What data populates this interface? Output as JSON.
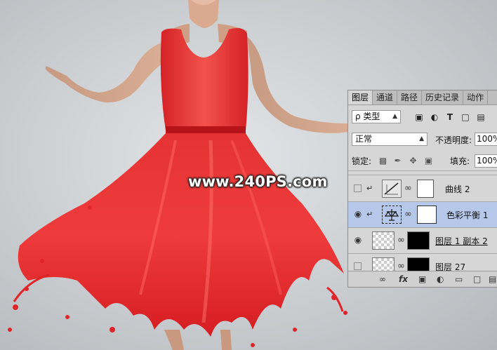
{
  "watermark": "www.240PS.com",
  "panel": {
    "tabs": [
      "图层",
      "通道",
      "路径",
      "历史记录",
      "动作"
    ],
    "filter": {
      "label": "ρ 类型"
    },
    "filter_icons": [
      "image-filter-icon",
      "adjustment-filter-icon",
      "text-filter-icon",
      "shape-filter-icon",
      "smart-object-filter-icon"
    ],
    "blend_mode": "正常",
    "opacity_label": "不透明度:",
    "opacity_value": "100%",
    "lock_label": "锁定:",
    "fill_label": "填充:",
    "fill_value": "100%",
    "layers": [
      {
        "name": "曲线 2",
        "visible": false,
        "clipped": true,
        "type": "curves"
      },
      {
        "name": "色彩平衡 1",
        "visible": true,
        "clipped": true,
        "type": "color-balance",
        "selected": true
      },
      {
        "name": "图层 1 副本 2",
        "visible": true,
        "clipped": false,
        "type": "pixel"
      },
      {
        "name": "图层 27",
        "visible": false,
        "clipped": false,
        "type": "pixel"
      }
    ],
    "bottom_icons": [
      "link-icon",
      "fx-icon",
      "mask-icon",
      "adjustment-icon",
      "folder-icon",
      "new-layer-icon",
      "trash-icon"
    ]
  },
  "colors": {
    "dress": "#e8262a",
    "selected_row": "#b5c8ea"
  }
}
